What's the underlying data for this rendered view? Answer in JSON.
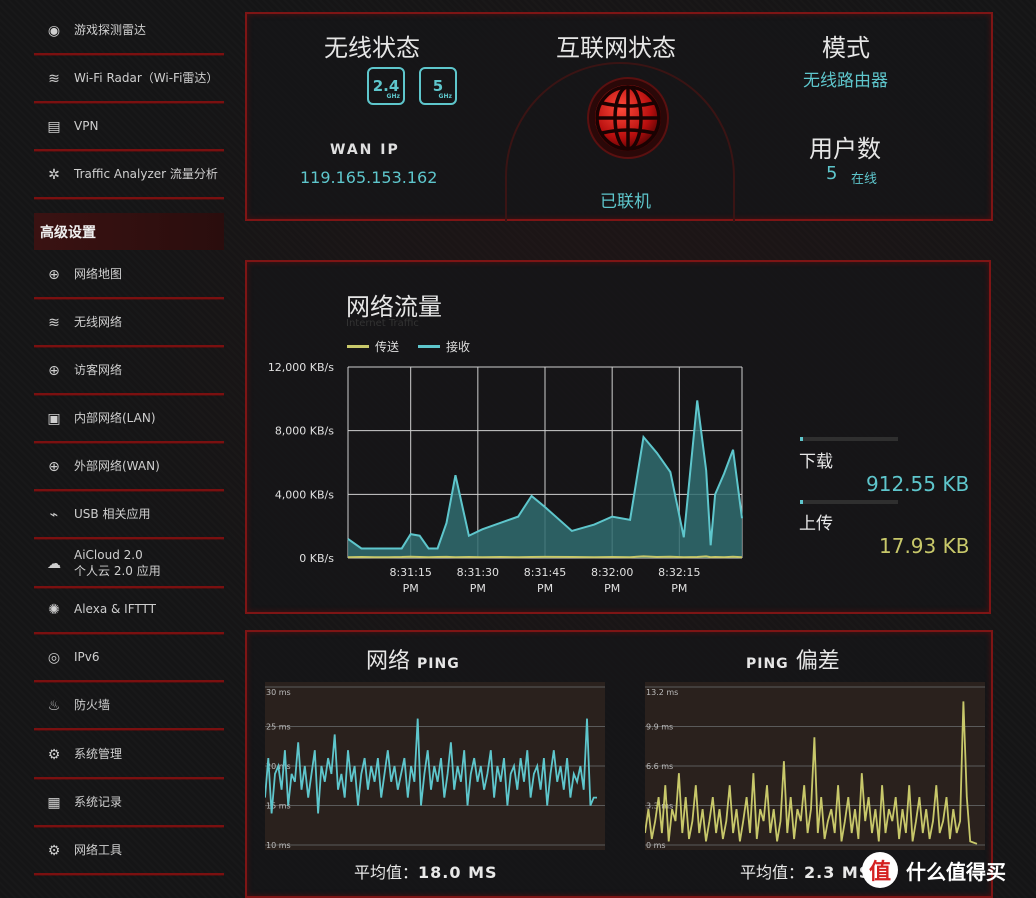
{
  "sidebar": {
    "items_top": [
      {
        "label": "游戏探测雷达",
        "icon": "radar-icon"
      },
      {
        "label": "Wi-Fi Radar（Wi-Fi雷达）",
        "icon": "wifi-radar-icon"
      },
      {
        "label": "VPN",
        "icon": "vpn-icon"
      },
      {
        "label": "Traffic Analyzer 流量分析",
        "icon": "traffic-analyzer-icon"
      }
    ],
    "section_header": "高级设置",
    "items_advanced": [
      {
        "label": "网络地图",
        "icon": "globe-icon"
      },
      {
        "label": "无线网络",
        "icon": "wireless-icon"
      },
      {
        "label": "访客网络",
        "icon": "guest-network-icon"
      },
      {
        "label": "内部网络(LAN)",
        "icon": "lan-icon"
      },
      {
        "label": "外部网络(WAN)",
        "icon": "wan-globe-icon"
      },
      {
        "label": "USB 相关应用",
        "icon": "usb-icon"
      },
      {
        "label": "AiCloud 2.0",
        "label2": "个人云 2.0 应用",
        "icon": "cloud-icon"
      },
      {
        "label": "Alexa & IFTTT",
        "icon": "alexa-icon"
      },
      {
        "label": "IPv6",
        "icon": "ipv6-icon"
      },
      {
        "label": "防火墙",
        "icon": "firewall-icon"
      },
      {
        "label": "系统管理",
        "icon": "gear-icon"
      },
      {
        "label": "系统记录",
        "icon": "log-icon"
      },
      {
        "label": "网络工具",
        "icon": "tools-icon"
      }
    ]
  },
  "status": {
    "wireless_title": "无线状态",
    "band_24": "2.4",
    "band_24_unit": "GHz",
    "band_5": "5",
    "band_5_unit": "GHz",
    "wan_ip_label": "WAN IP",
    "wan_ip": "119.165.153.162",
    "internet_title": "互联网状态",
    "internet_state": "已联机",
    "mode_title": "模式",
    "mode_value": "无线路由器",
    "users_title": "用户数",
    "users_count": "5",
    "users_suffix": "在线"
  },
  "traffic": {
    "title": "网络流量",
    "subtitle": "Internet Traffic",
    "download_label": "下载",
    "download_value": "912.55 KB",
    "upload_label": "上传",
    "upload_value": "17.93 KB"
  },
  "ping": {
    "ping_title_cn": "网络",
    "ping_title_en": "PING",
    "jitter_title_en": "PING",
    "jitter_title_cn": "偏差",
    "avg_label": "平均值：",
    "ping_avg": "18.0 MS",
    "jitter_avg": "2.3 MS"
  },
  "watermark": {
    "logo": "值",
    "text": "什么值得买"
  },
  "colors": {
    "accent_red": "#7e1515",
    "cyan": "#5ec6cc",
    "yellow": "#c8c86a"
  },
  "chart_data": [
    {
      "type": "area",
      "title": "网络流量",
      "ylabel": "",
      "ylim": [
        0,
        12000
      ],
      "yticks": [
        "0 KB/s",
        "4,000 KB/s",
        "8,000 KB/s",
        "12,000 KB/s"
      ],
      "xticks": [
        [
          "8:31:15",
          "PM"
        ],
        [
          "8:31:30",
          "PM"
        ],
        [
          "8:31:45",
          "PM"
        ],
        [
          "8:32:00",
          "PM"
        ],
        [
          "8:32:15",
          "PM"
        ]
      ],
      "xtick_pos": [
        14,
        29,
        44,
        59,
        74
      ],
      "xlim": [
        0,
        88
      ],
      "legend": "top-left",
      "series": [
        {
          "name": "传送",
          "color": "#c8c86a",
          "x": [
            0,
            3,
            6,
            9,
            12,
            14,
            16,
            18,
            20,
            22,
            24,
            27,
            30,
            34,
            38,
            41,
            44,
            50,
            55,
            59,
            63,
            66,
            69,
            72,
            75,
            78,
            80,
            81,
            82,
            84,
            86,
            88
          ],
          "values": [
            50,
            60,
            50,
            50,
            60,
            80,
            60,
            50,
            60,
            70,
            50,
            60,
            50,
            60,
            50,
            60,
            70,
            60,
            50,
            60,
            50,
            100,
            60,
            80,
            50,
            60,
            100,
            50,
            60,
            50,
            80,
            50
          ]
        },
        {
          "name": "接收",
          "color": "#5ec6cc",
          "x": [
            0,
            3,
            6,
            9,
            12,
            14,
            16,
            18,
            20,
            22,
            24,
            27,
            30,
            34,
            38,
            41,
            44,
            50,
            55,
            59,
            63,
            66,
            69,
            72,
            75,
            78,
            80,
            81,
            82,
            84,
            86,
            88
          ],
          "values": [
            1200,
            600,
            600,
            600,
            600,
            1500,
            1400,
            600,
            600,
            2200,
            5200,
            1400,
            1800,
            2200,
            2600,
            3900,
            3200,
            1700,
            2100,
            2600,
            2400,
            7600,
            6600,
            5400,
            1300,
            9900,
            5500,
            800,
            4000,
            5300,
            6800,
            2500
          ]
        }
      ]
    },
    {
      "type": "line",
      "title": "网络 PING",
      "ylim": [
        10,
        30
      ],
      "yticks": [
        "10 ms",
        "15 ms",
        "20 ms",
        "25 ms",
        "30 ms"
      ],
      "series": [
        {
          "name": "",
          "color": "#5ec6cc",
          "values": [
            16,
            21,
            14,
            19,
            20,
            17,
            22,
            15,
            19,
            18,
            23,
            17,
            20,
            16,
            19,
            22,
            14,
            20,
            18,
            21,
            19,
            24,
            17,
            19,
            16,
            22,
            18,
            20,
            15,
            19,
            21,
            17,
            20,
            18,
            21,
            16,
            19,
            22,
            18,
            20,
            17,
            19,
            21,
            16,
            20,
            18,
            26,
            15,
            19,
            22,
            17,
            20,
            18,
            21,
            16,
            19,
            23,
            17,
            20,
            18,
            22,
            15,
            19,
            21,
            18,
            20,
            17,
            19,
            22,
            16,
            20,
            18,
            21,
            15,
            19,
            20,
            17,
            21,
            18,
            22,
            16,
            19,
            20,
            17,
            21,
            15,
            19,
            22,
            18,
            20,
            17,
            21,
            16,
            19,
            18,
            20,
            17,
            26,
            15,
            16,
            16
          ]
        }
      ]
    },
    {
      "type": "line",
      "title": "PING 偏差",
      "ylim": [
        0,
        13.2
      ],
      "yticks": [
        "0 ms",
        "3.3 ms",
        "6.6 ms",
        "9.9 ms",
        "13.2 ms"
      ],
      "series": [
        {
          "name": "",
          "color": "#c8c86a",
          "values": [
            1,
            3,
            0.5,
            2,
            4,
            1,
            5,
            0.3,
            3,
            2,
            6,
            1,
            4,
            0.5,
            2,
            5,
            1,
            3,
            0.3,
            2,
            4,
            1,
            3,
            0.5,
            2,
            5,
            1,
            3,
            0.3,
            2,
            4,
            1,
            6,
            0.5,
            3,
            2,
            5,
            1,
            3,
            0.3,
            2,
            7,
            1,
            4,
            0.5,
            3,
            2,
            5,
            1,
            3,
            9,
            1,
            4,
            0.5,
            2,
            3,
            1,
            5,
            0.3,
            2,
            4,
            1,
            3,
            0.5,
            6,
            2,
            4,
            1,
            3,
            0.3,
            5,
            1,
            3,
            2,
            4,
            0.5,
            3,
            1,
            5,
            0.3,
            2,
            4,
            1,
            3,
            0.5,
            2,
            5,
            1,
            2,
            4,
            0.5,
            3,
            1,
            2,
            12,
            4,
            0.3,
            0.2,
            0.1
          ]
        }
      ]
    }
  ]
}
